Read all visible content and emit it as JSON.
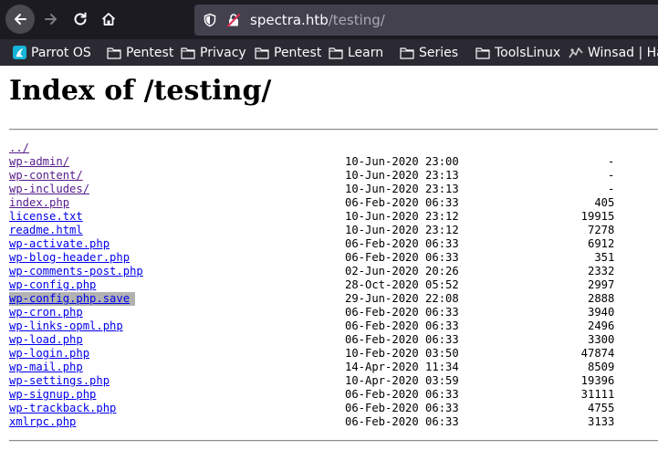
{
  "browser": {
    "url_host": "spectra.htb",
    "url_path": "/testing/",
    "bookmarks": [
      {
        "label": "Parrot OS",
        "icon": "parrot-icon"
      },
      {
        "label": "Pentest",
        "icon": "folder-icon"
      },
      {
        "label": "Privacy",
        "icon": "folder-icon"
      },
      {
        "label": "Pentest",
        "icon": "folder-icon"
      },
      {
        "label": "Learn",
        "icon": "folder-icon"
      },
      {
        "label": "Series",
        "icon": "folder-icon"
      },
      {
        "label": "ToolsLinux",
        "icon": "folder-icon"
      },
      {
        "label": "Winsad | Ha",
        "icon": "winsad-icon"
      }
    ]
  },
  "page": {
    "title": "Index of /testing/",
    "parent_link": "../",
    "entries": [
      {
        "name": "wp-admin/",
        "date": "10-Jun-2020 23:00",
        "size": "-"
      },
      {
        "name": "wp-content/",
        "date": "10-Jun-2020 23:13",
        "size": "-"
      },
      {
        "name": "wp-includes/",
        "date": "10-Jun-2020 23:13",
        "size": "-"
      },
      {
        "name": "index.php",
        "date": "06-Feb-2020 06:33",
        "size": "405"
      },
      {
        "name": "license.txt",
        "date": "10-Jun-2020 23:12",
        "size": "19915"
      },
      {
        "name": "readme.html",
        "date": "10-Jun-2020 23:12",
        "size": "7278"
      },
      {
        "name": "wp-activate.php",
        "date": "06-Feb-2020 06:33",
        "size": "6912"
      },
      {
        "name": "wp-blog-header.php",
        "date": "06-Feb-2020 06:33",
        "size": "351"
      },
      {
        "name": "wp-comments-post.php",
        "date": "02-Jun-2020 20:26",
        "size": "2332"
      },
      {
        "name": "wp-config.php",
        "date": "28-Oct-2020 05:52",
        "size": "2997"
      },
      {
        "name": "wp-config.php.save",
        "date": "29-Jun-2020 22:08",
        "size": "2888"
      },
      {
        "name": "wp-cron.php",
        "date": "06-Feb-2020 06:33",
        "size": "3940"
      },
      {
        "name": "wp-links-opml.php",
        "date": "06-Feb-2020 06:33",
        "size": "2496"
      },
      {
        "name": "wp-load.php",
        "date": "06-Feb-2020 06:33",
        "size": "3300"
      },
      {
        "name": "wp-login.php",
        "date": "10-Feb-2020 03:50",
        "size": "47874"
      },
      {
        "name": "wp-mail.php",
        "date": "14-Apr-2020 11:34",
        "size": "8509"
      },
      {
        "name": "wp-settings.php",
        "date": "10-Apr-2020 03:59",
        "size": "19396"
      },
      {
        "name": "wp-signup.php",
        "date": "06-Feb-2020 06:33",
        "size": "31111"
      },
      {
        "name": "wp-trackback.php",
        "date": "06-Feb-2020 06:33",
        "size": "4755"
      },
      {
        "name": "xmlrpc.php",
        "date": "06-Feb-2020 06:33",
        "size": "3133"
      }
    ]
  },
  "colors": {
    "toolbar_bg": "#1c1b22",
    "bookmarks_bg": "#2b2a33",
    "link": "#0000ee",
    "visited_link": "#551a8b",
    "selection": "#b2b2b2"
  }
}
